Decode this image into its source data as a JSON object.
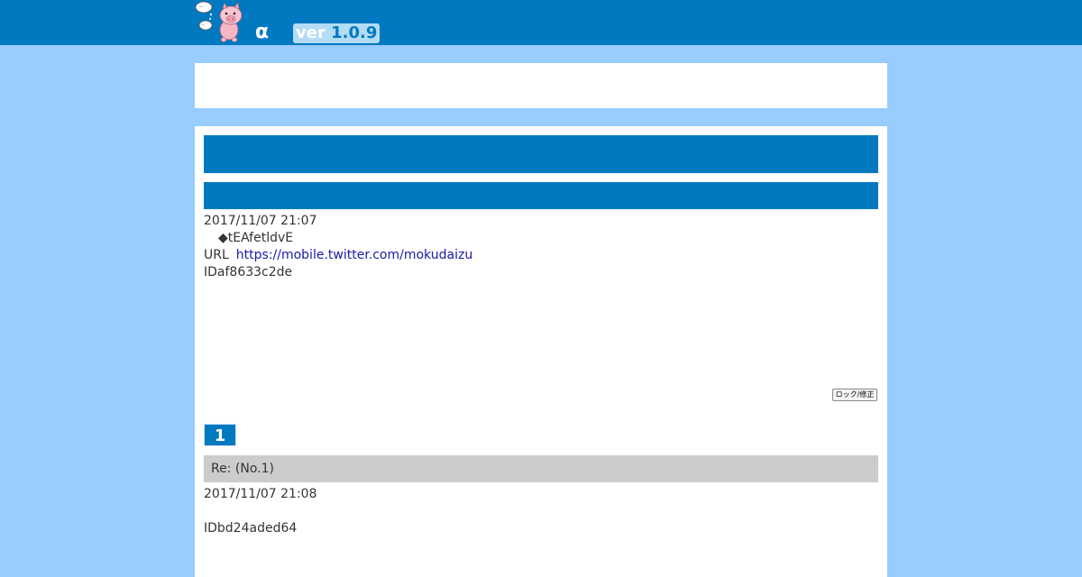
{
  "header": {
    "logo_icon": "pig-mascot-with-speech-bubbles-icon",
    "alpha": "α",
    "version_word": "ver",
    "version_number": "1.0.9",
    "colors": {
      "bar": "#0079c1",
      "background": "#99ccff"
    }
  },
  "post": {
    "date": "2017/11/07 21:07",
    "trip": "◆tEAfetldvE",
    "url_label": "URL",
    "url": "https://mobile.twitter.com/mokudaizu",
    "id": "IDaf8633c2de",
    "lock_button_label": "ロック/修正"
  },
  "reply": {
    "number": "1",
    "title": "Re:  (No.1)",
    "date": "2017/11/07 21:08",
    "id": "IDbd24aded64"
  }
}
